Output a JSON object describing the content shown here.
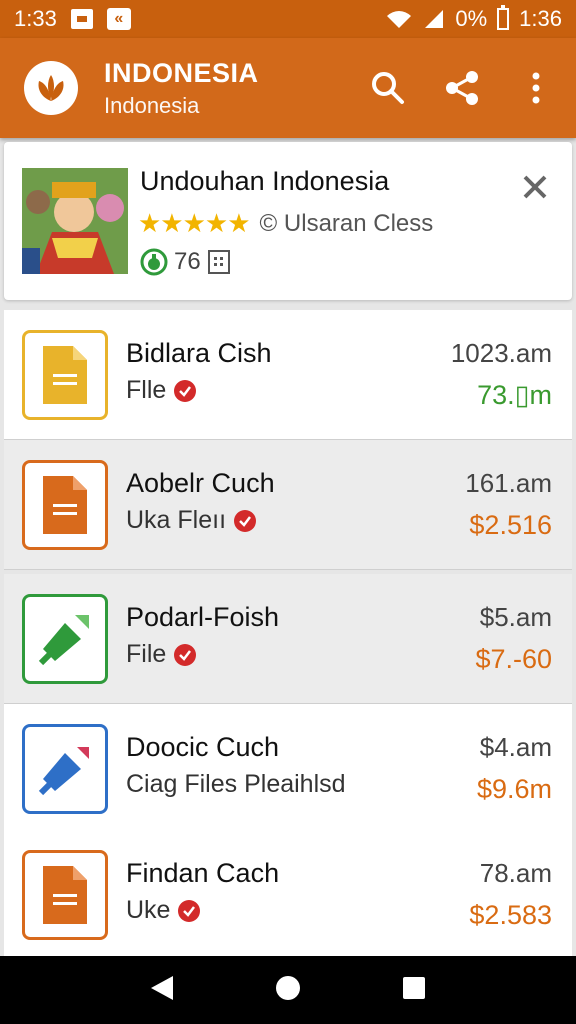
{
  "status": {
    "time_left": "1:33",
    "battery": "0%",
    "time_right": "1:36"
  },
  "appbar": {
    "title": "INDONESIA",
    "subtitle": "Indonesia"
  },
  "featured": {
    "title": "Undouhan Indonesia",
    "rating_stars": "★★★★★",
    "rating_text": "© Ulsaran Cless",
    "count": "76"
  },
  "rows": [
    {
      "title": "Bidlara Cish",
      "sub": "Flle",
      "time": "1023.am",
      "price": "73.▯m",
      "price_color": "#3a9a2f",
      "icon_color": "#e8b32b",
      "icon": "doc-yellow"
    },
    {
      "title": "Aobelr Cuch",
      "sub": "Uka Fleıı",
      "time": "161.am",
      "price": "$2.516",
      "price_color": "#d96b12",
      "icon_color": "#d86a1c",
      "icon": "doc-orange"
    },
    {
      "title": "Podarl-Foish",
      "sub": "File",
      "time": "$5.am",
      "price": "$7.-60",
      "price_color": "#d96b12",
      "icon_color": "#2f9a3b",
      "icon": "pin-green"
    },
    {
      "title": "Doocic Cuch",
      "sub": "Ciag Files Pleaihlsd",
      "time": "$4.am",
      "price": "$9.6m",
      "price_color": "#d96b12",
      "icon_color": "#2e6fc7",
      "icon": "pin-blue"
    },
    {
      "title": "Findan Cach",
      "sub": "Uke",
      "time": "78.am",
      "price": "$2.583",
      "price_color": "#d96b12",
      "icon_color": "#d86a1c",
      "icon": "doc-orange"
    }
  ]
}
